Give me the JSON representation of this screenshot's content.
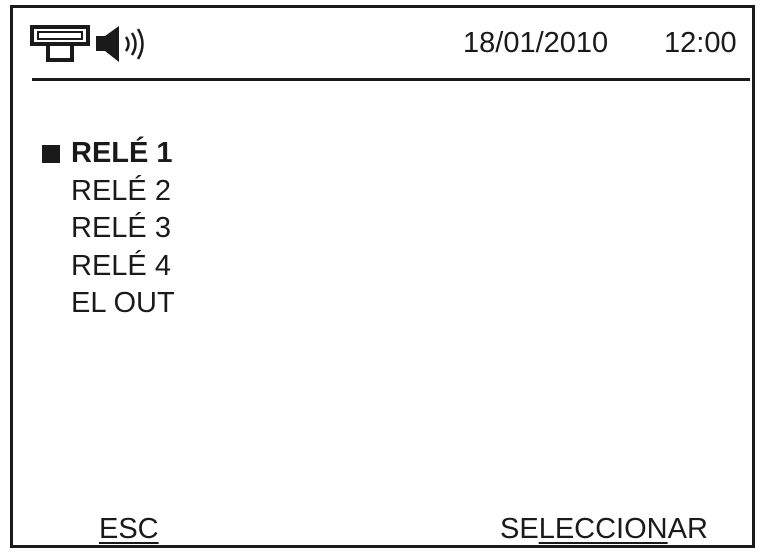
{
  "header": {
    "icons": [
      "network-icon",
      "speaker-icon"
    ],
    "date": "18/01/2010",
    "time": "12:00"
  },
  "menu": {
    "selected_index": 0,
    "items": [
      {
        "label": "RELÉ 1"
      },
      {
        "label": "RELÉ 2"
      },
      {
        "label": "RELÉ 3"
      },
      {
        "label": "RELÉ 4"
      },
      {
        "label": "EL OUT"
      }
    ]
  },
  "softkeys": {
    "left_label": "ESC",
    "right_label_prefix": "SE",
    "right_label_underlined": "LECCION",
    "right_label_suffix": "AR"
  },
  "colors": {
    "foreground": "#1a1a1a",
    "background": "#ffffff"
  }
}
